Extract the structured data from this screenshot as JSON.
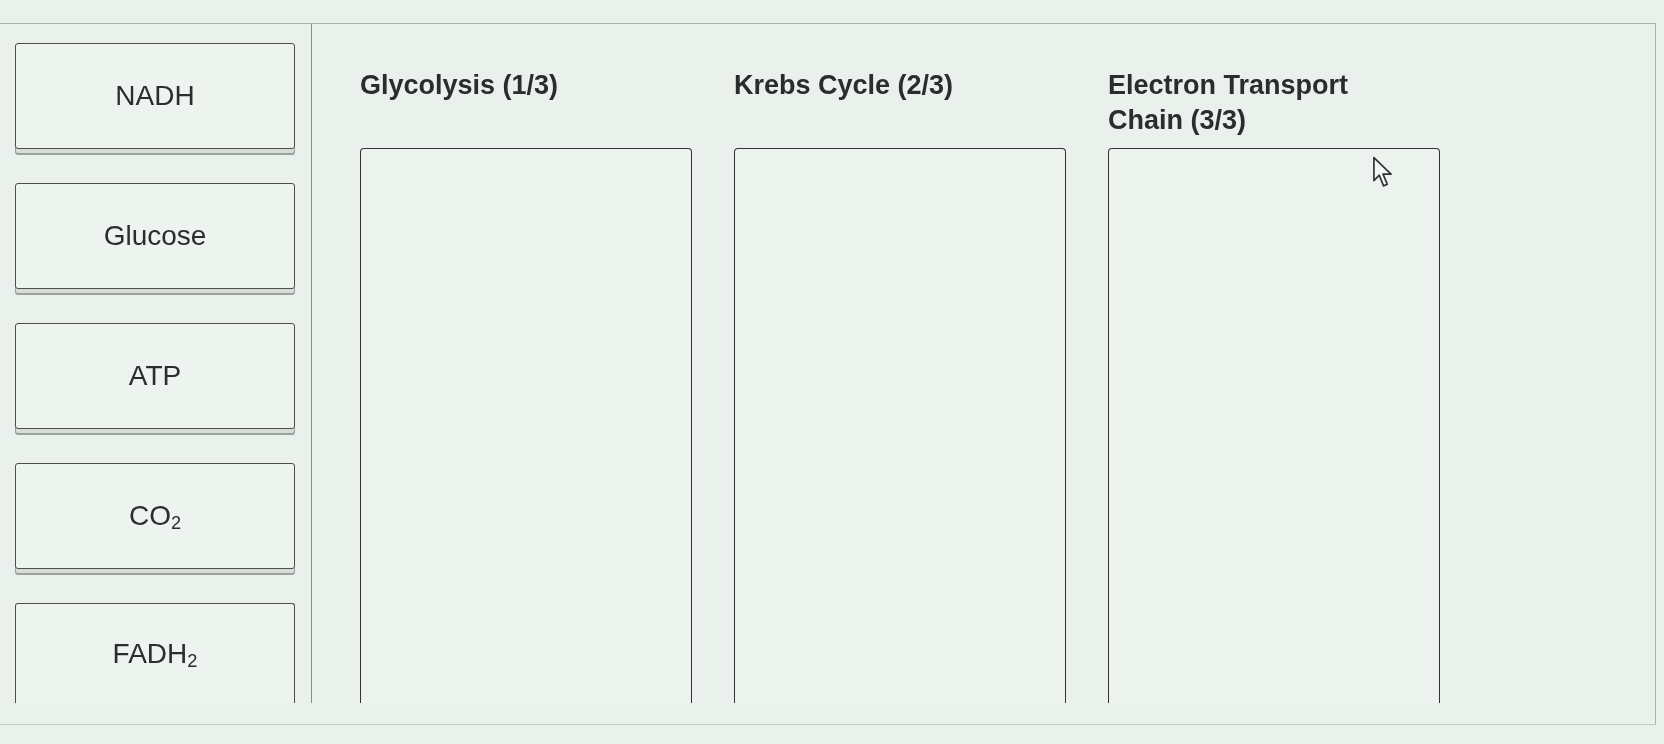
{
  "choices": [
    {
      "label": "NADH"
    },
    {
      "label": "Glucose"
    },
    {
      "label": "ATP"
    },
    {
      "label": "CO$_{2}$"
    },
    {
      "label": "FADH$_{2}$"
    }
  ],
  "categories": [
    {
      "title": "Glycolysis (1/3)"
    },
    {
      "title": "Krebs Cycle (2/3)"
    },
    {
      "title": "Electron Transport Chain (3/3)"
    }
  ]
}
